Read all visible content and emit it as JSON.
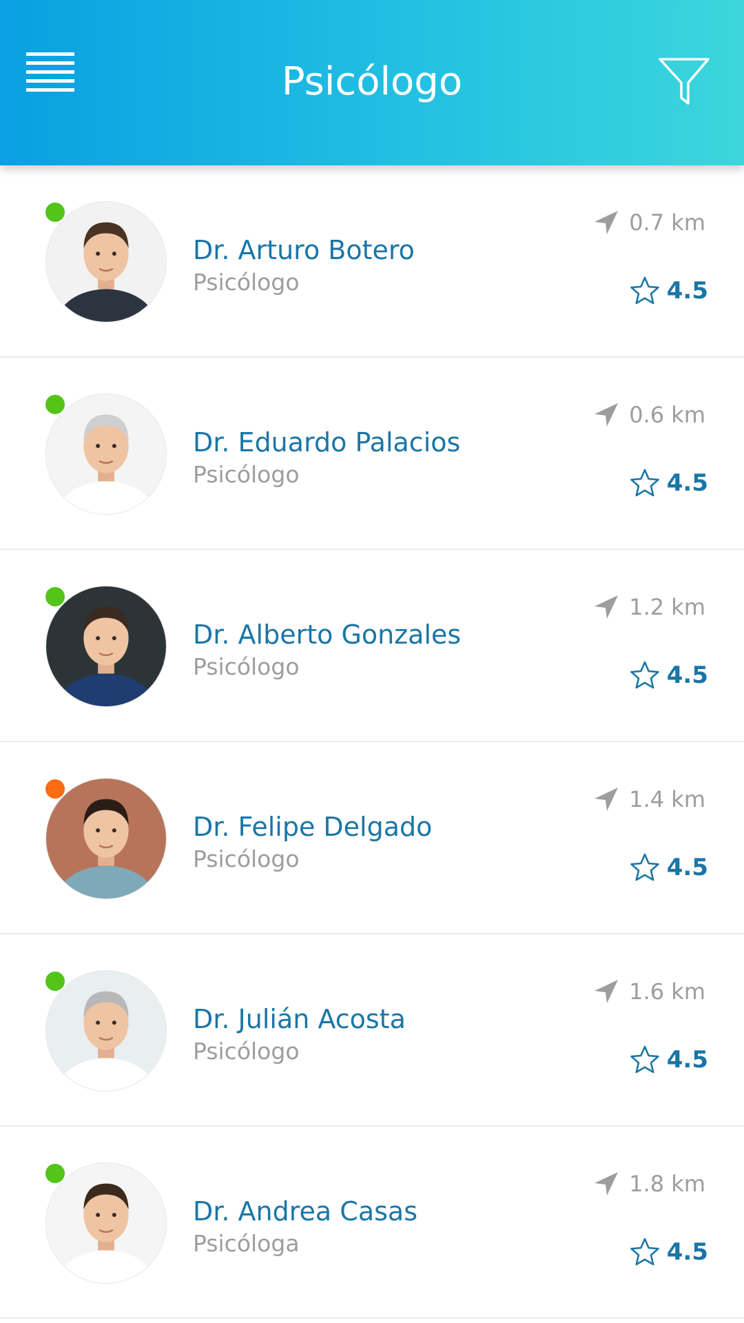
{
  "header": {
    "title": "Psicólogo",
    "menu_icon": "hamburger-menu-icon",
    "filter_icon": "filter-icon",
    "gradient": [
      "#0aa0e2",
      "#3cd6dc"
    ]
  },
  "colors": {
    "online": "#52c41a",
    "busy": "#ff6a13",
    "accent": "#1a76a6",
    "muted": "#9d9d9d"
  },
  "doctors": [
    {
      "name": "Dr. Arturo Botero",
      "specialty": "Psicólogo",
      "distance": "0.7 km",
      "rating": "4.5",
      "status": "online"
    },
    {
      "name": "Dr. Eduardo Palacios",
      "specialty": "Psicólogo",
      "distance": "0.6 km",
      "rating": "4.5",
      "status": "online"
    },
    {
      "name": "Dr. Alberto Gonzales",
      "specialty": "Psicólogo",
      "distance": "1.2 km",
      "rating": "4.5",
      "status": "online"
    },
    {
      "name": "Dr. Felipe Delgado",
      "specialty": "Psicólogo",
      "distance": "1.4 km",
      "rating": "4.5",
      "status": "busy"
    },
    {
      "name": "Dr. Julián Acosta",
      "specialty": "Psicólogo",
      "distance": "1.6 km",
      "rating": "4.5",
      "status": "online"
    },
    {
      "name": "Dr. Andrea Casas",
      "specialty": "Psicóloga",
      "distance": "1.8 km",
      "rating": "4.5",
      "status": "online"
    }
  ]
}
